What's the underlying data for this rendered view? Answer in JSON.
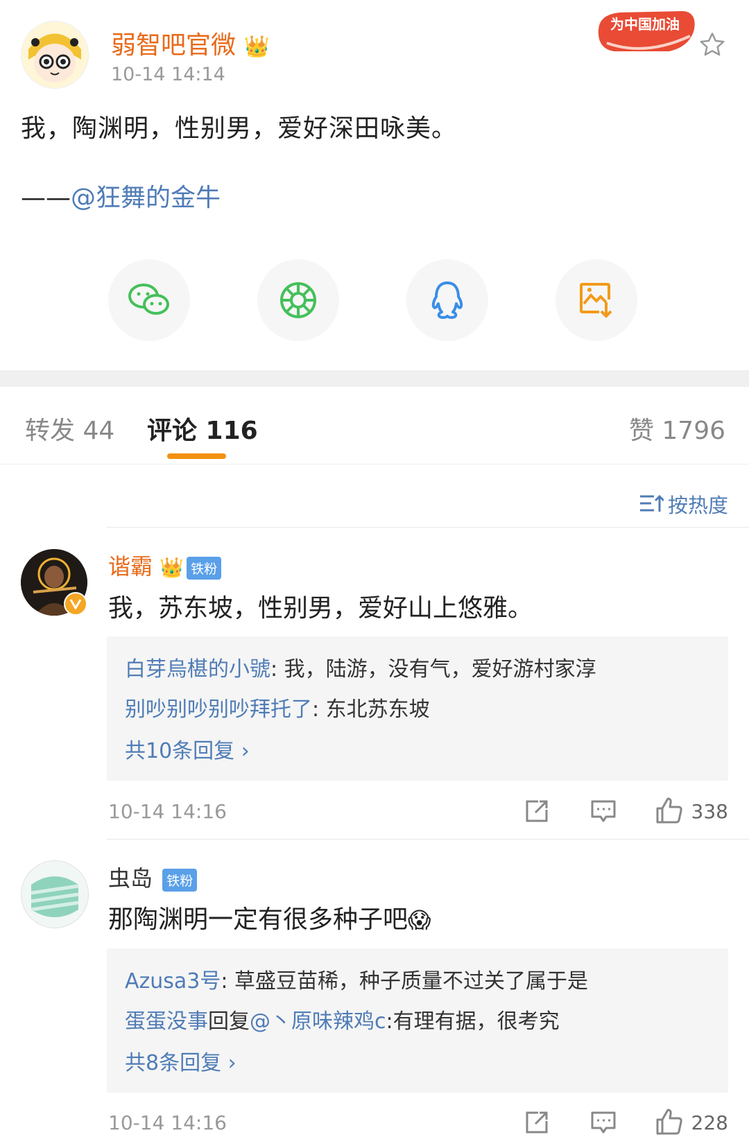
{
  "post": {
    "username": "弱智吧官微",
    "time": "10-14 14:14",
    "text": "我，陶渊明，性别男，爱好深田咏美。",
    "signature_prefix": "——",
    "signature_mention": "@狂舞的金牛",
    "badge_text": "为中国加油"
  },
  "share": {
    "icons": [
      "wechat-icon",
      "moments-icon",
      "qq-icon",
      "save-image-icon"
    ]
  },
  "tabs": {
    "repost": "转发 44",
    "comments": "评论 116",
    "likes": "赞 1796"
  },
  "sort": {
    "label": "按热度"
  },
  "comments": [
    {
      "user": "谐霸",
      "user_color": "#e86a1a",
      "badge": "铁粉",
      "text": "我，苏东坡，性别男，爱好山上悠雅。",
      "replies": [
        {
          "who": "白芽烏椹的小號",
          "text": ": 我，陆游，没有气，爱好游村家淳"
        },
        {
          "who": "别吵别吵别吵拜托了",
          "text": ": 东北苏东坡"
        }
      ],
      "more": "共10条回复 ›",
      "time": "10-14 14:16",
      "likes": "338"
    },
    {
      "user": "虫岛",
      "user_color": "#333333",
      "badge": "铁粉",
      "text": "那陶渊明一定有很多种子吧",
      "replies": [
        {
          "who": "Azusa3号",
          "text": ": 草盛豆苗稀，种子质量不过关了属于是"
        },
        {
          "who": "蛋蛋没事",
          "mid": "回复",
          "who2": "@丶原味辣鸡c",
          "text": ":有理有据，很考究"
        }
      ],
      "more": "共8条回复 ›",
      "time": "10-14 14:16",
      "likes": "228"
    }
  ]
}
